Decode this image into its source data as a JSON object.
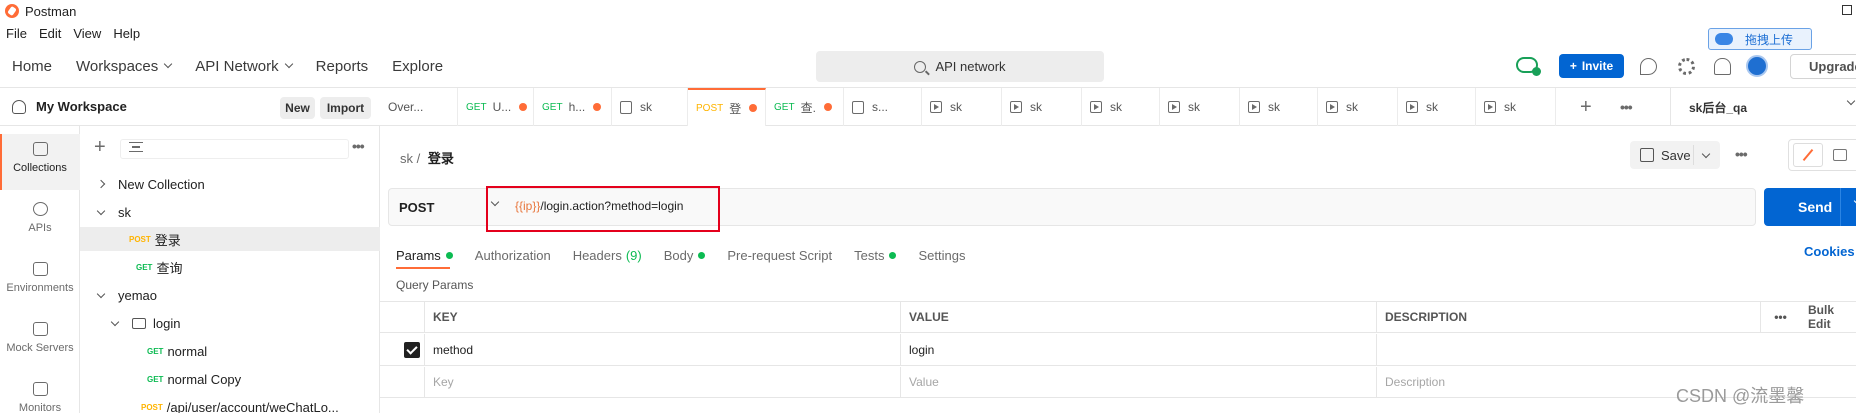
{
  "window": {
    "title": "Postman"
  },
  "menu": [
    "File",
    "Edit",
    "View",
    "Help"
  ],
  "nav": {
    "home": "Home",
    "workspaces": "Workspaces",
    "api_network": "API Network",
    "reports": "Reports",
    "explore": "Explore"
  },
  "search": {
    "placeholder": "API network"
  },
  "header": {
    "invite": "Invite",
    "upgrade": "Upgrade",
    "plus": "+"
  },
  "overlay": {
    "upload_label": "拖拽上传"
  },
  "rail": [
    {
      "label": "Collections",
      "icon": "collections-icon"
    },
    {
      "label": "APIs",
      "icon": "apis-icon"
    },
    {
      "label": "Environments",
      "icon": "environments-icon"
    },
    {
      "label": "Mock Servers",
      "icon": "mock-servers-icon"
    },
    {
      "label": "Monitors",
      "icon": "monitors-icon"
    }
  ],
  "workspace": {
    "name": "My Workspace",
    "new": "New",
    "import": "Import",
    "more": "•••"
  },
  "tree": [
    {
      "label": "New Collection",
      "method": ""
    },
    {
      "label": "sk",
      "method": ""
    },
    {
      "label": "登录",
      "method": "POST"
    },
    {
      "label": "查询",
      "method": "GET"
    },
    {
      "label": "yemao",
      "method": ""
    },
    {
      "label": "login",
      "method": ""
    },
    {
      "label": "normal",
      "method": "GET"
    },
    {
      "label": "normal Copy",
      "method": "GET"
    },
    {
      "label": "/api/user/account/weChatLo...",
      "method": "POST"
    }
  ],
  "tabs": [
    {
      "method": "",
      "label": "Over...",
      "dot": false
    },
    {
      "method": "GET",
      "label": "U...",
      "dot": true
    },
    {
      "method": "GET",
      "label": "h...",
      "dot": true
    },
    {
      "method": "",
      "label": "sk",
      "dot": false
    },
    {
      "method": "POST",
      "label": "登",
      "dot": true
    },
    {
      "method": "GET",
      "label": "查.",
      "dot": true
    },
    {
      "method": "",
      "label": "s...",
      "dot": false
    },
    {
      "method": "",
      "label": "sk",
      "dot": false
    },
    {
      "method": "",
      "label": "sk",
      "dot": false
    },
    {
      "method": "",
      "label": "sk",
      "dot": false
    },
    {
      "method": "",
      "label": "sk",
      "dot": false
    },
    {
      "method": "",
      "label": "sk",
      "dot": false
    },
    {
      "method": "",
      "label": "sk",
      "dot": false
    },
    {
      "method": "",
      "label": "sk",
      "dot": false
    },
    {
      "method": "",
      "label": "sk",
      "dot": false
    }
  ],
  "environment": "sk后台_qa",
  "tab_more": "•••",
  "request": {
    "collection": "sk",
    "separator": "/",
    "name": "登录",
    "save": "Save",
    "more": "•••",
    "method": "POST",
    "url_var": "{{ip}}",
    "url_rest": "/login.action?method=login",
    "send": "Send"
  },
  "req_tabs": {
    "params": "Params",
    "authorization": "Authorization",
    "headers": "Headers",
    "headers_count": "(9)",
    "body": "Body",
    "prerequest": "Pre-request Script",
    "tests": "Tests",
    "settings": "Settings",
    "cookies": "Cookies"
  },
  "query_params": {
    "title": "Query Params",
    "headers": {
      "key": "KEY",
      "value": "VALUE",
      "description": "DESCRIPTION",
      "more": "•••",
      "bulk": "Bulk Edit"
    },
    "rows": [
      {
        "key": "method",
        "value": "login",
        "checked": true
      }
    ],
    "placeholders": {
      "key": "Key",
      "value": "Value",
      "description": "Description"
    }
  },
  "watermark": "CSDN @流墨馨",
  "colors": {
    "accent": "#ff6c37",
    "send": "#0265d2",
    "get": "#0cbb52",
    "post": "#ffb400",
    "annotation": "#e4001c"
  }
}
